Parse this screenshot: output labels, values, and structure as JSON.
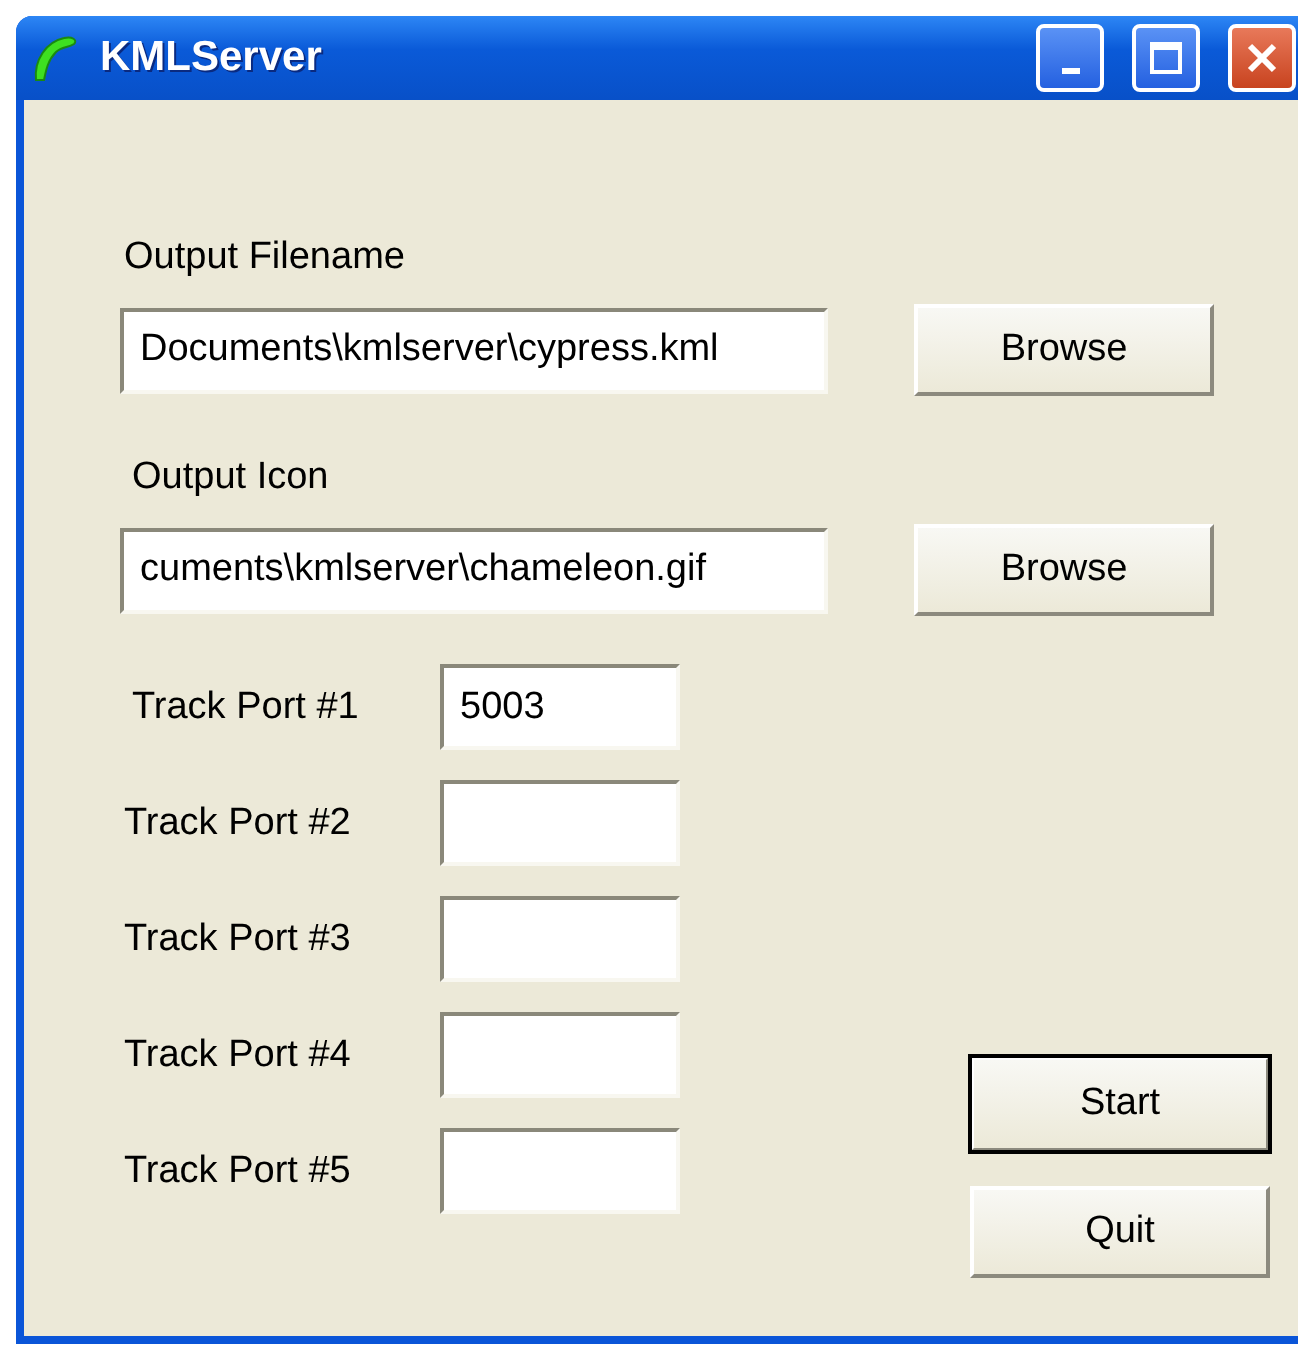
{
  "window": {
    "title": "KMLServer"
  },
  "file_fields": [
    {
      "label": "Output Filename",
      "value": "Documents\\kmlserver\\cypress.kml",
      "button": "Browse"
    },
    {
      "label": "Output Icon",
      "value": "cuments\\kmlserver\\chameleon.gif",
      "button": "Browse"
    }
  ],
  "track_ports": [
    {
      "label": "Track Port #1",
      "value": "5003"
    },
    {
      "label": "Track Port #2"
    },
    {
      "label": "Track Port #3"
    },
    {
      "label": "Track Port #4"
    },
    {
      "label": "Track Port #5"
    }
  ],
  "buttons": [
    {
      "label": "Start",
      "default": true
    },
    {
      "label": "Quit",
      "default": false
    }
  ]
}
